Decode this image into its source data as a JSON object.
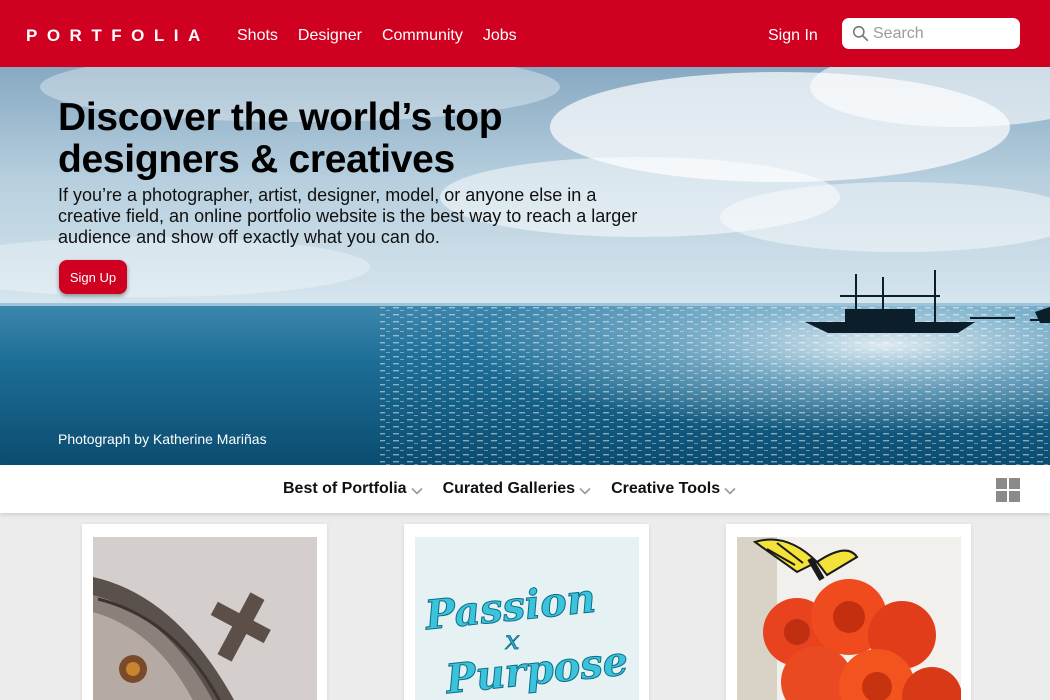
{
  "header": {
    "logo": "PORTFOLIA",
    "nav": [
      "Shots",
      "Designer",
      "Community",
      "Jobs"
    ],
    "sign_in": "Sign In",
    "search_placeholder": "Search"
  },
  "hero": {
    "title": "Discover the world’s top designers & creatives",
    "description": "If you’re a photographer, artist, designer, model, or anyone else in a creative field, an online portfolio website is the best way to reach a larger audience and show off exactly what you can do.",
    "cta": "Sign Up",
    "credit": "Photograph by Katherine Mariñas"
  },
  "subnav": {
    "items": [
      "Best of Portfolia",
      "Curated Galleries",
      "Creative Tools"
    ]
  },
  "cards": [
    {
      "image": "cross-on-stone-photo"
    },
    {
      "image": "passion-purpose-lettering",
      "text_line1": "Passion",
      "text_x": "x",
      "text_line2": "Purpose"
    },
    {
      "image": "butterfly-on-roses-photo"
    }
  ],
  "colors": {
    "brand": "#cf0020",
    "background": "#ececec"
  }
}
